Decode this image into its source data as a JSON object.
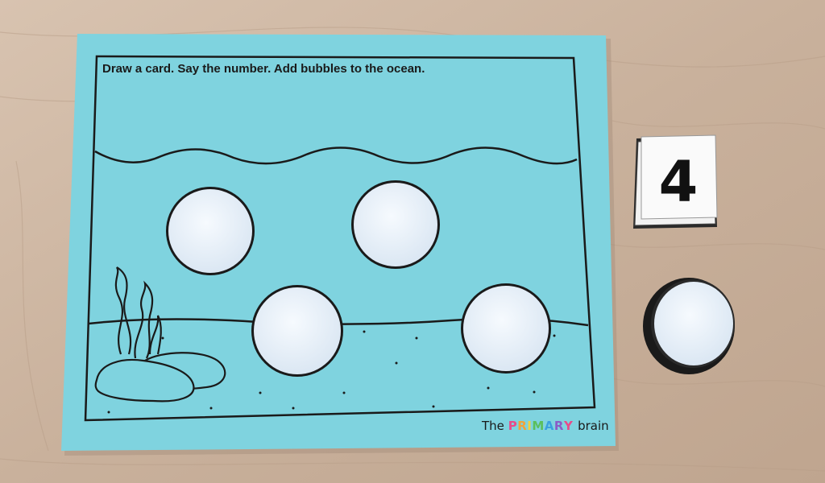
{
  "scene": {
    "instructions": "Draw a card. Say the number. Add bubbles to the ocean.",
    "card_number": "4",
    "brand": {
      "prefix": "The",
      "highlight": "PRIMARY",
      "suffix": "brain"
    },
    "colors": {
      "table": "#cbb39f",
      "mat": "#7fd3df",
      "bubble": "#eaf3fb",
      "ink": "#1a1a1a"
    },
    "bubbles_on_mat": 4
  }
}
